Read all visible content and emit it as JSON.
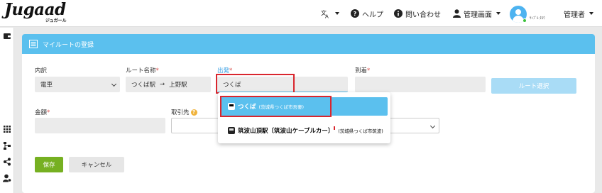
{
  "header": {
    "logo": "Jugaad",
    "logo_sub": "ジュガール",
    "language_icon": "translate-icon",
    "help_label": "ヘルプ",
    "contact_label": "問い合わせ",
    "admin_label": "管理画面",
    "avatar_name": "ｻﾝﾌﾟﾙ ﾀﾛｳ",
    "user_menu_label": "管理者"
  },
  "panel": {
    "title": "マイルートの登録",
    "title_icon": "list-icon"
  },
  "form": {
    "breakdown": {
      "label": "内訳",
      "value": "電車"
    },
    "route_name": {
      "label": "ルート名称",
      "required": "*",
      "from": "つくば駅",
      "arrow": "→",
      "to": "上野駅"
    },
    "departure": {
      "label": "出発",
      "required": "*",
      "value": "つくば"
    },
    "arrival": {
      "label": "到着",
      "required": "*",
      "value": ""
    },
    "route_select_button": "ルート選択",
    "amount": {
      "label": "金額",
      "required": "*",
      "value": ""
    },
    "client": {
      "label": "取引先",
      "help": "?",
      "value": ""
    },
    "save_button": "保存",
    "cancel_button": "キャンセル"
  },
  "suggestions": [
    {
      "name": "つくば",
      "detail": "(茨城県つくば市吾妻)",
      "selected": true,
      "icon": "train-icon"
    },
    {
      "name": "筑波山頂駅〔筑波山ケーブルカー〕",
      "detail": "(茨城県つくば市筑波)",
      "selected": false,
      "icon": "train-icon"
    }
  ],
  "colors": {
    "accent": "#5bc0ee",
    "highlight": "#d9262e",
    "save": "#76b021",
    "required": "#d9534f"
  }
}
